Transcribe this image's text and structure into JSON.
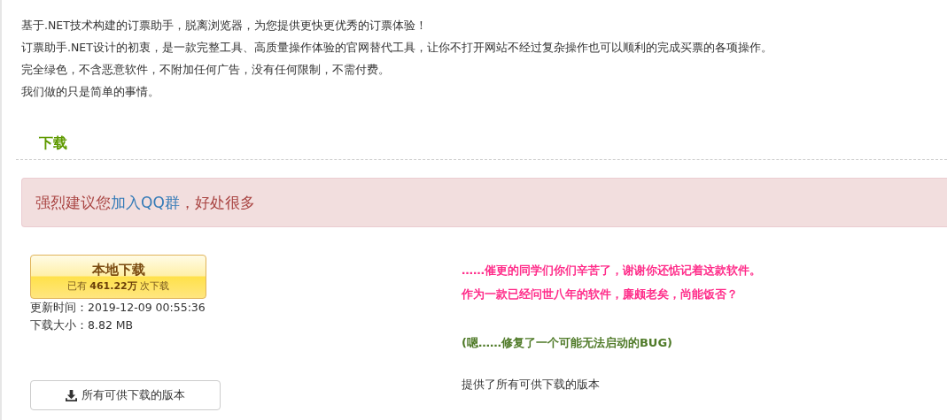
{
  "intro": [
    "基于.NET技术构建的订票助手，脱离浏览器，为您提供更快更优秀的订票体验！",
    "订票助手.NET设计的初衷，是一款完整工具、高质量操作体验的官网替代工具，让你不打开网站不经过复杂操作也可以顺利的完成买票的各项操作。",
    "完全绿色，不含恶意软件，不附加任何广告，没有任何限制，不需付费。",
    "我们做的只是简单的事情。"
  ],
  "section_title": "下载",
  "alert": {
    "before": "强烈建议您",
    "link": "加入QQ群",
    "after": "，好处很多"
  },
  "download_button": {
    "title": "本地下载",
    "count": "已有 **461.22万** 次下载"
  },
  "details": [
    "更新时间：2019-12-09 00:55:36",
    "下载大小：8.82 MB"
  ],
  "versions_button": {
    "label": "所有可供下载的版本"
  },
  "notes": [
    {
      "kind": "highlight",
      "text": "……催更的同学们你们辛苦了，谢谢你还惦记着这款软件。"
    },
    {
      "kind": "highlight",
      "text": "作为一款已经问世八年的软件，廉颇老矣，尚能饭否？"
    },
    {
      "kind": "spacer"
    },
    {
      "kind": "fix",
      "text": "(嗯……修复了一个可能无法启动的BUG)"
    },
    {
      "kind": "spacer"
    },
    {
      "kind": "plain",
      "text": "提供了所有可供下载的版本"
    }
  ]
}
